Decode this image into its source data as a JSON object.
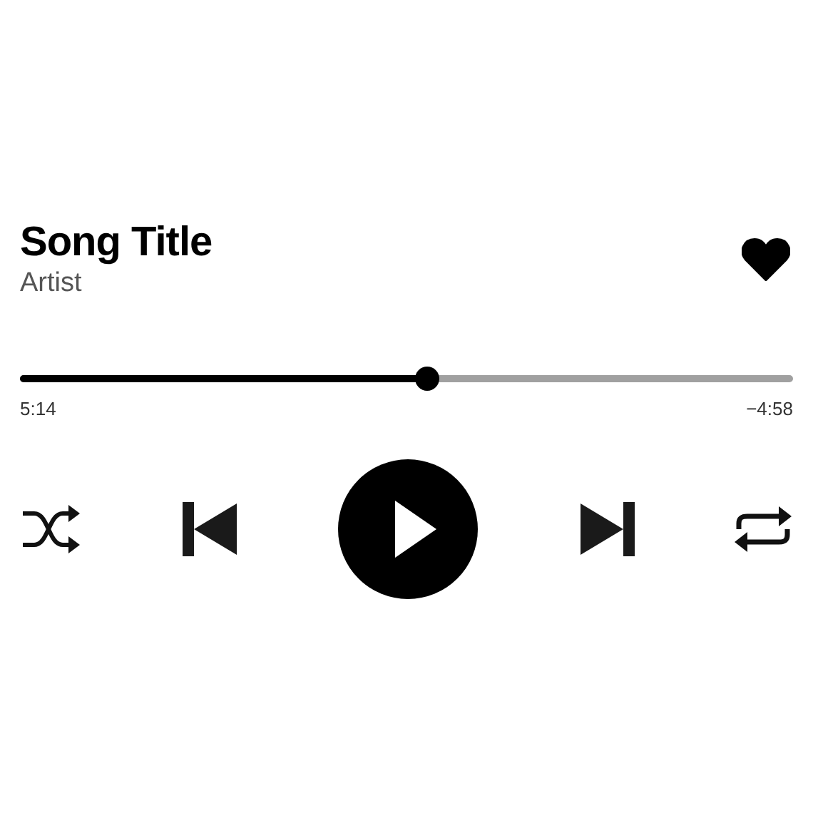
{
  "track": {
    "title": "Song Title",
    "artist": "Artist",
    "liked": true
  },
  "progress": {
    "level": 0.525,
    "elapsed": "5:14",
    "remaining": "−4:58"
  },
  "controls": {
    "playing": false
  }
}
